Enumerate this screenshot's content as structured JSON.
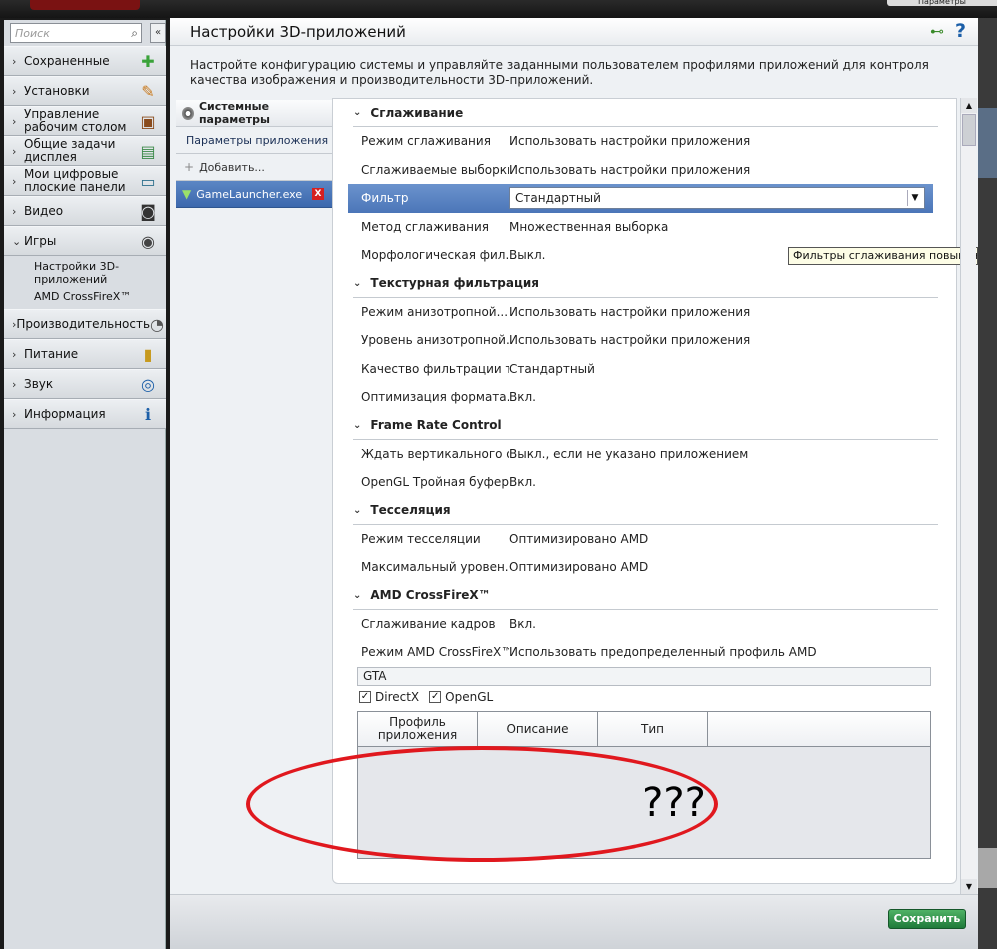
{
  "header": {
    "params_label": "Параметры"
  },
  "sidebar": {
    "search_placeholder": "Поиск",
    "collapse_label": "«",
    "items": [
      {
        "label": "Сохраненные",
        "icon": "pin-icon",
        "glyph": "✚",
        "color": "#3aa33a"
      },
      {
        "label": "Установки",
        "icon": "settings-icon",
        "glyph": "✎",
        "color": "#c97a1e"
      },
      {
        "label": "Управление рабочим столом",
        "icon": "desktop-icon",
        "glyph": "▣",
        "color": "#8a4b1c"
      },
      {
        "label": "Общие задачи дисплея",
        "icon": "display-tasks-icon",
        "glyph": "▤",
        "color": "#3c8a4a"
      },
      {
        "label": "Мои цифровые плоские панели",
        "icon": "monitor-icon",
        "glyph": "▭",
        "color": "#2c6f8c"
      },
      {
        "label": "Видео",
        "icon": "video-camera-icon",
        "glyph": "◙",
        "color": "#333333"
      },
      {
        "label": "Игры",
        "icon": "gamepad-icon",
        "glyph": "◉",
        "color": "#444444"
      },
      {
        "label": "Производительность",
        "icon": "gauge-icon",
        "glyph": "◔",
        "color": "#555555"
      },
      {
        "label": "Питание",
        "icon": "battery-icon",
        "glyph": "▮",
        "color": "#c79a1e"
      },
      {
        "label": "Звук",
        "icon": "speaker-icon",
        "glyph": "◎",
        "color": "#1c5fa8"
      },
      {
        "label": "Информация",
        "icon": "info-icon",
        "glyph": "ℹ",
        "color": "#1c5fa8"
      }
    ],
    "games_sub": [
      "Настройки 3D-приложений",
      "AMD CrossFireX™"
    ]
  },
  "main": {
    "title": "Настройки 3D-приложений",
    "description": "Настройте конфигурацию системы и управляйте заданными пользователем профилями приложений для контроля качества изображения и производительности 3D-приложений.",
    "profiles": {
      "system": "Системные параметры",
      "app_params": "Параметры приложения",
      "add": "Добавить...",
      "game": "GameLauncher.exe",
      "remove": "X"
    },
    "sections": [
      {
        "title": "Сглаживание",
        "rows": [
          {
            "label": "Режим сглаживания",
            "value": "Использовать настройки приложения"
          },
          {
            "label": "Сглаживаемые выборки",
            "value": "Использовать настройки приложения"
          },
          {
            "label": "Фильтр",
            "value": "Стандартный",
            "selected": true
          },
          {
            "label": "Метод сглаживания",
            "value": "Множественная выборка"
          },
          {
            "label": "Морфологическая фил...",
            "value": "Выкл."
          }
        ]
      },
      {
        "title": "Текстурная фильтрация",
        "rows": [
          {
            "label": "Режим анизотропной...",
            "value": "Использовать настройки приложения"
          },
          {
            "label": "Уровень анизотропной...",
            "value": "Использовать настройки приложения"
          },
          {
            "label": "Качество фильтрации т...",
            "value": "Стандартный"
          },
          {
            "label": "Оптимизация формата...",
            "value": "Вкл."
          }
        ]
      },
      {
        "title": "Frame Rate Control",
        "rows": [
          {
            "label": "Ждать вертикального о...",
            "value": "Выкл., если не указано приложением"
          },
          {
            "label": "OpenGL Тройная буфер...",
            "value": "Вкл."
          }
        ]
      },
      {
        "title": "Тесселяция",
        "rows": [
          {
            "label": "Режим тесселяции",
            "value": "Оптимизировано AMD"
          },
          {
            "label": "Максимальный уровен...",
            "value": "Оптимизировано AMD"
          }
        ]
      },
      {
        "title": "AMD CrossFireX™",
        "rows": [
          {
            "label": "Сглаживание кадров",
            "value": "Вкл."
          },
          {
            "label": "Режим AMD CrossFireX™",
            "value": "Использовать предопределенный профиль AMD"
          }
        ]
      }
    ],
    "tooltip": "Фильтры сглаживания повышают эффе",
    "search_value": "GTA",
    "checkboxes": [
      {
        "label": "DirectX",
        "checked": true
      },
      {
        "label": "OpenGL",
        "checked": true
      }
    ],
    "table_headers": [
      "Профиль приложения",
      "Описание",
      "Тип",
      ""
    ],
    "annotation": "???",
    "save_label": "Сохранить"
  }
}
